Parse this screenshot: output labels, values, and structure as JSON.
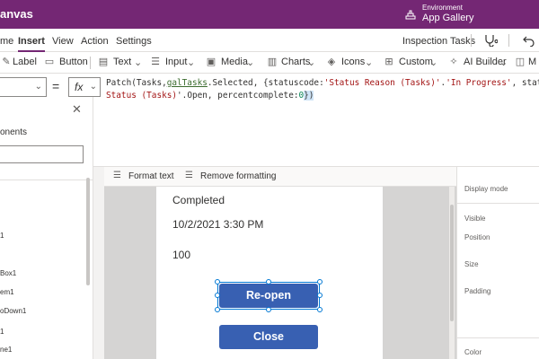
{
  "titlebar": {
    "app_name": "anvas",
    "environment_label": "Environment",
    "environment_name": "App Gallery"
  },
  "menu": {
    "tabs": [
      "me",
      "Insert",
      "View",
      "Action",
      "Settings"
    ],
    "active": "Insert",
    "app_name": "Inspection Tasks"
  },
  "ribbon": {
    "label": "Label",
    "button": "Button",
    "text": "Text",
    "input": "Input",
    "media": "Media",
    "charts": "Charts",
    "icons": "Icons",
    "custom": "Custom",
    "ai_builder": "AI Builder",
    "mixed_reality": "M"
  },
  "formula": {
    "eq": "=",
    "fx": "fx",
    "line1": {
      "p1": "Patch(Tasks,",
      "p2": "galTasks",
      "p3": ".Selected, {statuscode:",
      "p4": "'Status Reason (Tasks)'",
      "p5": ".",
      "p6": "'In Progress'",
      "p7": ", statecod"
    },
    "line2": {
      "p1": "Status (Tasks)",
      "p2": "'.Open, percentcomplete:",
      "p3": "0",
      "p4": "})"
    }
  },
  "leftpanel": {
    "heading": "onents",
    "tree": [
      "1",
      "Box1",
      "em1",
      "oDown1",
      "1",
      "ne1"
    ]
  },
  "format": {
    "format_text": "Format text",
    "remove_formatting": "Remove formatting"
  },
  "screen": {
    "status": "Completed",
    "date": "10/2/2021 3:30 PM",
    "percent": "100",
    "reopen": "Re-open",
    "close": "Close"
  },
  "properties": {
    "display_mode": "Display mode",
    "visible": "Visible",
    "position": "Position",
    "size": "Size",
    "padding": "Padding",
    "color": "Color"
  }
}
